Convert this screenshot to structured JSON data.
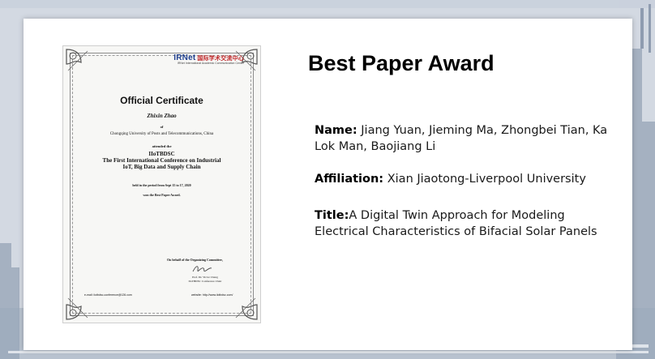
{
  "award": {
    "heading": "Best Paper Award",
    "name_label": "Name:",
    "name_value": " Jiang Yuan, Jieming Ma, Zhongbei Tian, Ka Lok Man, Baojiang Li",
    "affiliation_label": "Affiliation:",
    "affiliation_value": " Xian Jiaotong-Liverpool University",
    "title_label": "Title:",
    "title_value": "A Digital Twin Approach for Modeling Electrical Characteristics of Bifacial Solar Panels"
  },
  "certificate": {
    "logo_text": "IRNet",
    "logo_cn": "国际学术交流中心",
    "logo_sub": "IRNet International Academic Communication Center",
    "title": "Official Certificate",
    "recipient": "Zhixin Zhao",
    "of": "of",
    "university": "Chongqing University of Posts and Telecommunications, China",
    "attended": "attended the",
    "conf_line1": "IIoTBDSC",
    "conf_line2": "The First International Conference on Industrial",
    "conf_line3": "IoT, Big Data and Supply Chain",
    "held": "held in the period from Sept 15 to 17, 2020",
    "won": "won the Best Paper Award.",
    "behalf": "On behalf of the Organizing Committee,",
    "prof_name": "Prof. Dr. Victor Chang",
    "prof_role": "IIoTBDSC Conference Chair",
    "email": "e-mail: iiotbdsc-conference@126.com",
    "website": "website: http://www.iiotbdsc.com/"
  }
}
